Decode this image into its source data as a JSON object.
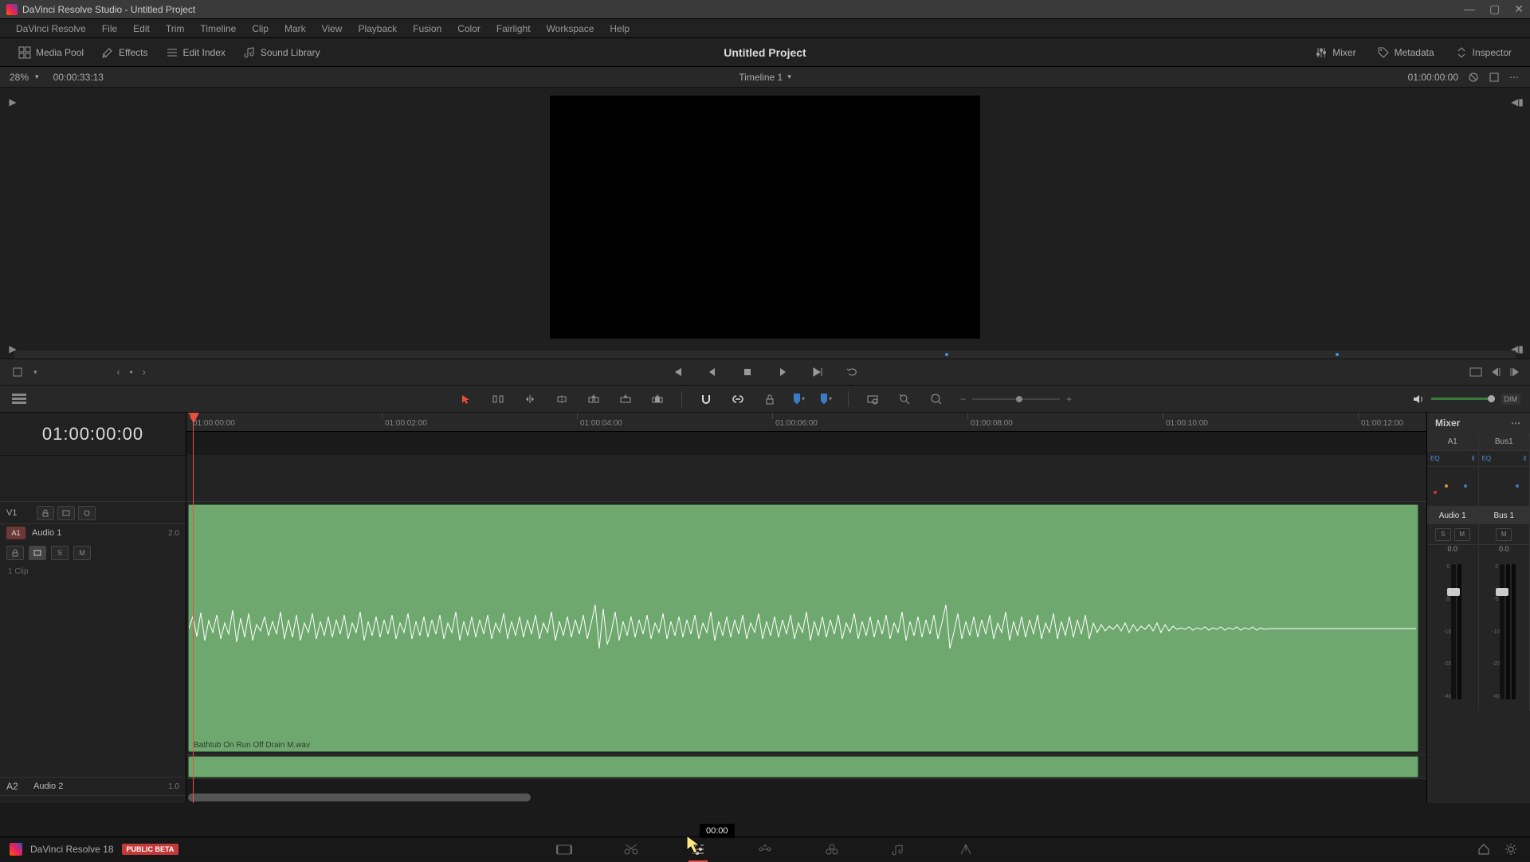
{
  "titlebar": {
    "title": "DaVinci Resolve Studio - Untitled Project"
  },
  "menu": [
    "DaVinci Resolve",
    "File",
    "Edit",
    "Trim",
    "Timeline",
    "Clip",
    "Mark",
    "View",
    "Playback",
    "Fusion",
    "Color",
    "Fairlight",
    "Workspace",
    "Help"
  ],
  "toolbar": {
    "media_pool": "Media Pool",
    "effects": "Effects",
    "edit_index": "Edit Index",
    "sound_library": "Sound Library",
    "mixer": "Mixer",
    "metadata": "Metadata",
    "inspector": "Inspector",
    "project_name": "Untitled Project"
  },
  "viewer_head": {
    "zoom": "28%",
    "source_tc": "00:00:33:13",
    "timeline_name": "Timeline 1",
    "record_tc": "01:00:00:00"
  },
  "transport": {},
  "timeline": {
    "timecode": "01:00:00:00",
    "clip_name": "Bathtub On Run Off Drain M.wav",
    "ruler": [
      "01:00:00:00",
      "01:00:02:00",
      "01:00:04:00",
      "01:00:06:00",
      "01:00:08:00",
      "01:00:10:00",
      "01:00:12:00"
    ],
    "tracks": {
      "v1": {
        "label": "V1"
      },
      "a1": {
        "patch": "A1",
        "name": "Audio 1",
        "channels": "2.0",
        "clips_txt": "1 Clip",
        "s": "S",
        "m": "M"
      },
      "a2": {
        "label": "A2",
        "name": "Audio 2",
        "channels": "1.0"
      }
    }
  },
  "mixer": {
    "title": "Mixer",
    "strips": [
      {
        "ch": "A1",
        "eq": "EQ",
        "track": "Audio 1",
        "s": "S",
        "m": "M",
        "db": "0.0"
      },
      {
        "ch": "Bus1",
        "eq": "EQ",
        "track": "Bus 1",
        "m": "M",
        "db": "0.0"
      }
    ]
  },
  "footer": {
    "brand": "DaVinci Resolve 18",
    "beta": "PUBLIC BETA"
  },
  "tooltip": {
    "text": "00:00"
  },
  "dim_label": "DIM"
}
